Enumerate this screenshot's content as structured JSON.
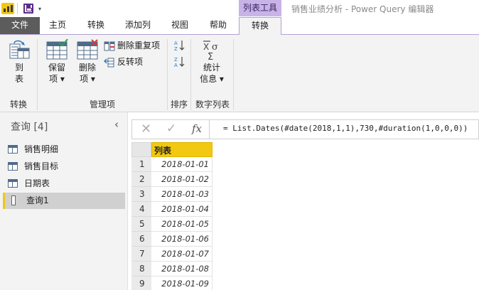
{
  "titlebar": {
    "contextual_tab_title": "列表工具",
    "window_title": "销售业绩分析 - Power Query 编辑器",
    "qat_dropdown": "▾"
  },
  "tabs": {
    "file": "文件",
    "home": "主页",
    "transform": "转换",
    "add_column": "添加列",
    "view": "视图",
    "help": "帮助",
    "list_transform": "转换"
  },
  "ribbon": {
    "to_table": {
      "line1": "到",
      "line2": "表"
    },
    "keep_items": {
      "line1": "保留",
      "line2": "项 ▾"
    },
    "remove_items": {
      "line1": "删除",
      "line2": "项 ▾"
    },
    "remove_duplicates": "删除重复项",
    "reverse_items": "反转项",
    "statistics": {
      "line1": "统计",
      "line2": "信息 ▾"
    },
    "group_convert": "转换",
    "group_manage_items": "管理项",
    "group_sort": "排序",
    "group_numeric_list": "数字列表"
  },
  "queries": {
    "header": "查询 [4]",
    "collapse_glyph": "‹",
    "items": [
      {
        "label": "销售明细",
        "type": "table"
      },
      {
        "label": "销售目标",
        "type": "table"
      },
      {
        "label": "日期表",
        "type": "table"
      },
      {
        "label": "查询1",
        "type": "list",
        "selected": true
      }
    ]
  },
  "formula_bar": {
    "cancel_glyph": "✕",
    "confirm_glyph": "✓",
    "fx_label": "fx",
    "formula": "= List.Dates(#date(2018,1,1),730,#duration(1,0,0,0))"
  },
  "grid": {
    "column_header": "列表",
    "rows": [
      {
        "n": "1",
        "value": "2018-01-01"
      },
      {
        "n": "2",
        "value": "2018-01-02"
      },
      {
        "n": "3",
        "value": "2018-01-03"
      },
      {
        "n": "4",
        "value": "2018-01-04"
      },
      {
        "n": "5",
        "value": "2018-01-05"
      },
      {
        "n": "6",
        "value": "2018-01-06"
      },
      {
        "n": "7",
        "value": "2018-01-07"
      },
      {
        "n": "8",
        "value": "2018-01-08"
      },
      {
        "n": "9",
        "value": "2018-01-09"
      }
    ]
  },
  "colors": {
    "accent_yellow": "#f2c811",
    "contextual_purple": "#c8b3e6",
    "file_tab_bg": "#5c5c5c"
  }
}
